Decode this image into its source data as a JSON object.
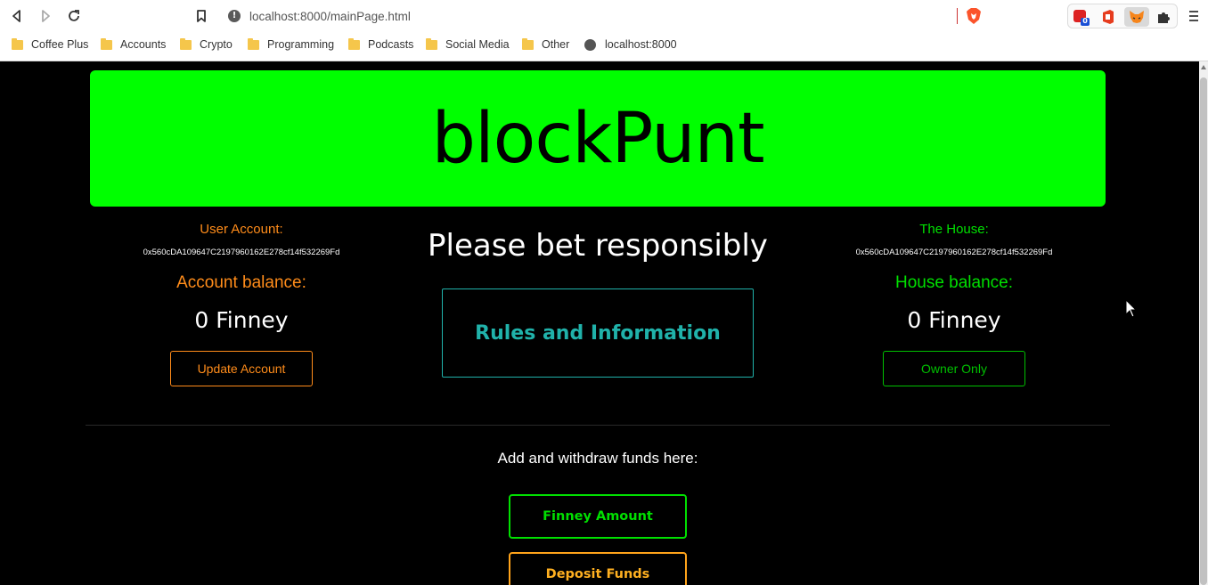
{
  "browser": {
    "url": "localhost:8000/mainPage.html",
    "bookmarks": [
      "Coffee Plus",
      "Accounts",
      "Crypto",
      "Programming",
      "Podcasts",
      "Social Media",
      "Other",
      "localhost:8000"
    ],
    "extension_badge": "0"
  },
  "banner": {
    "title": "blockPunt"
  },
  "user": {
    "label": "User Account:",
    "address": "0x560cDA109647C2197960162E278cf14f532269Fd",
    "balance_label": "Account balance:",
    "balance_value": "0 Finney",
    "button": "Update Account"
  },
  "center": {
    "tagline": "Please bet responsibly",
    "rules_button": "Rules and Information"
  },
  "house": {
    "label": "The House:",
    "address": "0x560cDA109647C2197960162E278cf14f532269Fd",
    "balance_label": "House balance:",
    "balance_value": "0 Finney",
    "button": "Owner Only"
  },
  "funds": {
    "label": "Add and withdraw funds here:",
    "amount_button": "Finney Amount",
    "deposit_button": "Deposit Funds"
  },
  "colors": {
    "banner": "#00ff00",
    "user_accent": "#ff8c1a",
    "house_accent": "#00e000",
    "rules_accent": "#20b2aa"
  }
}
